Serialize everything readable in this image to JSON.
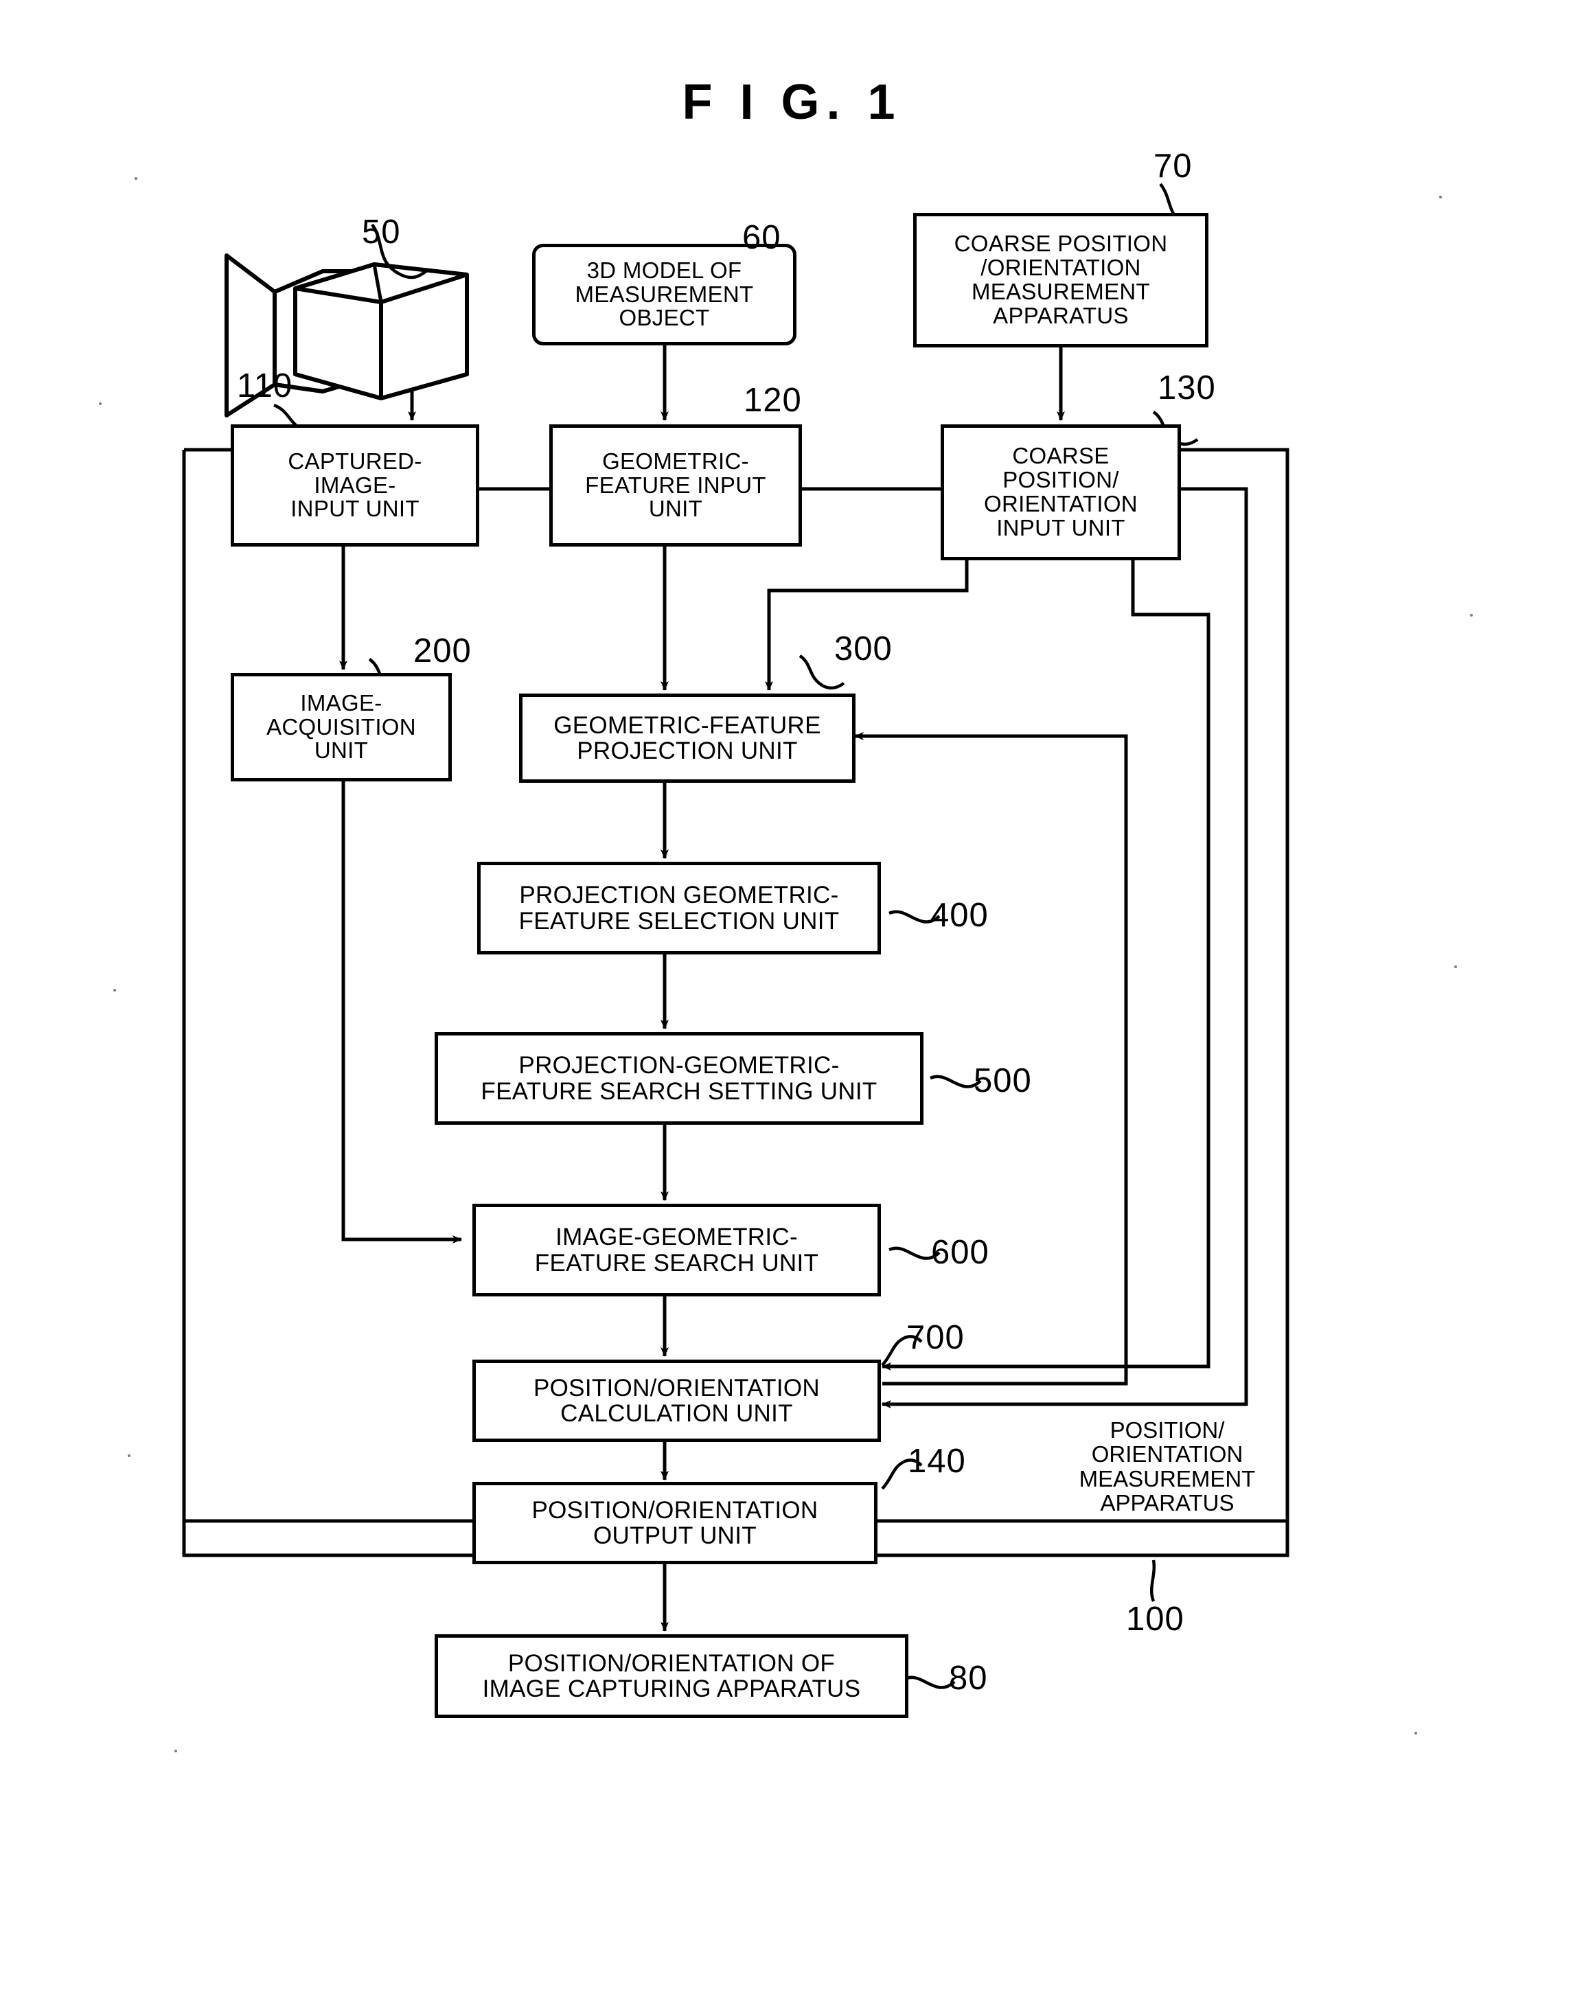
{
  "figure": {
    "title": "F I G.  1"
  },
  "nodes": {
    "camera": {
      "ref": "50",
      "name": "image capturing apparatus icon"
    },
    "model3d": {
      "label": "3D MODEL OF\nMEASUREMENT\nOBJECT",
      "ref": "60"
    },
    "coarseApparatus": {
      "label": "COARSE POSITION\n/ORIENTATION\nMEASUREMENT\nAPPARATUS",
      "ref": "70"
    },
    "capturedImageInput": {
      "label": "CAPTURED-\nIMAGE-\nINPUT UNIT",
      "ref": "110"
    },
    "geometricFeatureInput": {
      "label": "GEOMETRIC-\nFEATURE INPUT\nUNIT",
      "ref": "120"
    },
    "coarsePosOrientInput": {
      "label": "COARSE\nPOSITION/\nORIENTATION\nINPUT UNIT",
      "ref": "130"
    },
    "imageAcquisition": {
      "label": "IMAGE-\nACQUISITION\nUNIT",
      "ref": "200"
    },
    "geometricFeatureProjection": {
      "label": "GEOMETRIC-FEATURE\nPROJECTION UNIT",
      "ref": "300"
    },
    "projectionGeomFeatureSelection": {
      "label": "PROJECTION GEOMETRIC-\nFEATURE SELECTION UNIT",
      "ref": "400"
    },
    "projectionGeomFeatureSearchSetting": {
      "label": "PROJECTION-GEOMETRIC-\nFEATURE SEARCH SETTING UNIT",
      "ref": "500"
    },
    "imageGeomFeatureSearch": {
      "label": "IMAGE-GEOMETRIC-\nFEATURE SEARCH UNIT",
      "ref": "600"
    },
    "positionOrientationCalculation": {
      "label": "POSITION/ORIENTATION\nCALCULATION UNIT",
      "ref": "700"
    },
    "positionOrientationOutput": {
      "label": "POSITION/ORIENTATION\nOUTPUT UNIT",
      "ref": "140"
    },
    "positionOrientationOfCamera": {
      "label": "POSITION/ORIENTATION OF\nIMAGE CAPTURING APPARATUS",
      "ref": "80"
    }
  },
  "container": {
    "label": "POSITION/\nORIENTATION\nMEASUREMENT\nAPPARATUS",
    "ref": "100"
  },
  "colors": {
    "ink": "#000000",
    "paper": "#ffffff"
  }
}
